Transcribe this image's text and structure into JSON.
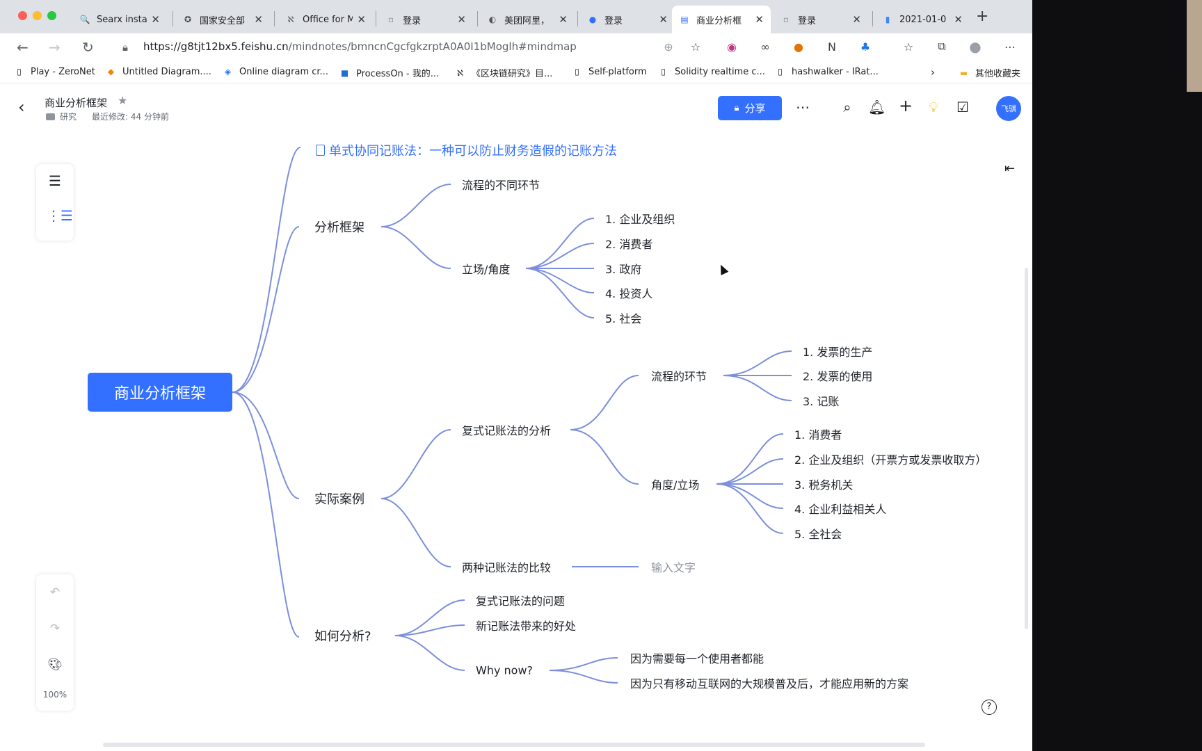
{
  "browser": {
    "tabs": [
      {
        "label": "Searx insta",
        "icon": "search-icon"
      },
      {
        "label": "国家安全部",
        "icon": "emblem-icon"
      },
      {
        "label": "Office for M",
        "icon": "office-icon"
      },
      {
        "label": "登录",
        "icon": "page-icon"
      },
      {
        "label": "美团阿里，",
        "icon": "article-icon"
      },
      {
        "label": "登录",
        "icon": "blue-circle-icon"
      },
      {
        "label": "商业分析框",
        "icon": "doc-icon"
      },
      {
        "label": "登录",
        "icon": "page-icon"
      },
      {
        "label": "2021-01-0",
        "icon": "docs-icon"
      }
    ],
    "url_host": "https://g8tjt12bx5.feishu.cn",
    "url_path": "/mindnotes/bmncnCgcfgkzrptA0A0I1bMoglh#mindmap",
    "bookmarks": [
      "Play - ZeroNet",
      "Untitled Diagram....",
      "Online diagram cr...",
      "ProcessOn - 我的...",
      "《区块链研究》目...",
      "Self-platform",
      "Solidity realtime c...",
      "hashwalker - IRat..."
    ],
    "other_bookmarks": "其他收藏夹"
  },
  "doc": {
    "title": "商业分析框架",
    "folder": "研究",
    "last_modified": "最近修改: 44 分钟前",
    "share_label": "分享",
    "avatar_text": "飞骐",
    "zoom": "100%"
  },
  "mindmap": {
    "root": "商业分析框架",
    "link_node": "单式协同记账法：一种可以防止财务造假的记账方法",
    "framework": "分析框架",
    "framework_children": [
      "流程的不同环节",
      "立场/角度"
    ],
    "stance_children": [
      "1. 企业及组织",
      "2. 消费者",
      "3. 政府",
      "4. 投资人",
      "5. 社会"
    ],
    "case": "实际案例",
    "case_children": [
      "复式记账法的分析",
      "两种记账法的比较"
    ],
    "double_entry_children": [
      "流程的环节",
      "角度/立场"
    ],
    "process_children": [
      "1. 发票的生产",
      "2. 发票的使用",
      "3. 记账"
    ],
    "angle_children": [
      "1. 消费者",
      "2. 企业及组织（开票方或发票收取方）",
      "3. 税务机关",
      "4. 企业利益相关人",
      "5. 全社会"
    ],
    "compare_placeholder": "输入文字",
    "how": "如何分析?",
    "how_children": [
      "复式记账法的问题",
      "新记账法带来的好处",
      "Why now?"
    ],
    "why_children": [
      "因为需要每一个使用者都能",
      "因为只有移动互联网的大规模普及后，才能应用新的方案"
    ]
  },
  "colors": {
    "accent": "#3370ff",
    "line": "#7b8fdc"
  }
}
